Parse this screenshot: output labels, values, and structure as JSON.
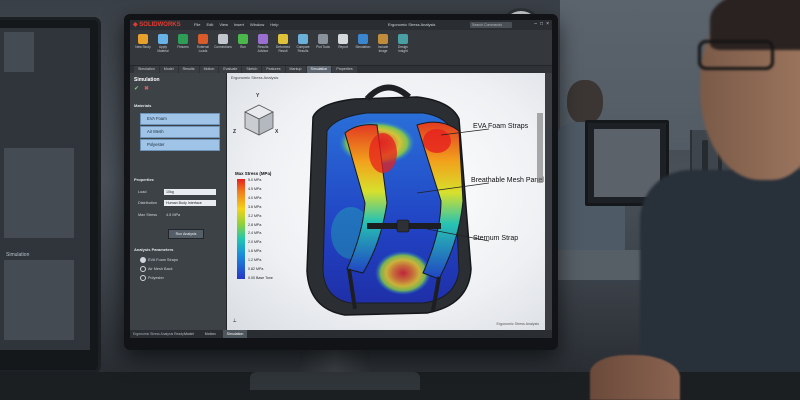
{
  "app": {
    "brand": "SOLIDWORKS",
    "menu": [
      "File",
      "Edit",
      "View",
      "Insert",
      "Window",
      "Help"
    ],
    "document_title": "Ergonomic Stress Analysis",
    "search_placeholder": "Search Commands"
  },
  "ribbon": {
    "buttons": [
      {
        "label": "New Study",
        "color": "#e7a02b"
      },
      {
        "label": "Apply Material",
        "color": "#67b2e6"
      },
      {
        "label": "Fixtures",
        "color": "#2e9e57"
      },
      {
        "label": "External Loads",
        "color": "#d95a2b"
      },
      {
        "label": "Connections",
        "color": "#c0c6cc"
      },
      {
        "label": "Run",
        "color": "#4bb84b"
      },
      {
        "label": "Results Advisor",
        "color": "#9b6fd1"
      },
      {
        "label": "Deformed Result",
        "color": "#e0c13a"
      },
      {
        "label": "Compare Results",
        "color": "#6ab0d8"
      },
      {
        "label": "Plot Tools",
        "color": "#8a939c"
      },
      {
        "label": "Report",
        "color": "#d6d9dc"
      },
      {
        "label": "Simulation",
        "color": "#3b86d1"
      },
      {
        "label": "Include Image",
        "color": "#c28d3a"
      },
      {
        "label": "Design Insight",
        "color": "#4a9fa5"
      }
    ]
  },
  "tabs": [
    "Simulation",
    "Model",
    "Results",
    "Motion",
    "Evaluate",
    "Sketch",
    "Features",
    "Markup",
    "Simulation",
    "Properties"
  ],
  "active_tab_index": 8,
  "panel": {
    "title": "Simulation",
    "materials_heading": "Materials",
    "materials": [
      "EVA Foam",
      "Air Mesh",
      "Polyester"
    ],
    "properties_heading": "Properties",
    "load_label": "Load",
    "load_value": "10kg",
    "distribution_label": "Distribution",
    "distribution_value": "Human Body Interface",
    "max_stress_label": "Max Stress",
    "max_stress_value": "4.5 MPa",
    "run_button": "Run Analysis",
    "analysis_heading": "Analysis Parameters",
    "options": [
      {
        "label": "EVA Foam Straps",
        "checked": true
      },
      {
        "label": "Air Mesh Back",
        "checked": false
      },
      {
        "label": "Polyester",
        "checked": false
      }
    ]
  },
  "viewport": {
    "title": "Ergonomic Stress Analysis",
    "legend_title": "Max Stress (MPa)",
    "legend_values": [
      "5.0 MPa",
      "4.5 MPa",
      "4.0 MPa",
      "3.6 MPa",
      "3.2 MPa",
      "2.8 MPa",
      "2.4 MPa",
      "2.0 MPa",
      "1.6 MPa",
      "1.2 MPa",
      "0.82 MPa",
      "0.00 Base Tone"
    ],
    "callouts": {
      "straps": "EVA Foam Straps",
      "panel": "Breathable Mesh Panel",
      "sternum": "Sternum Strap"
    },
    "cube_axes": {
      "y": "Y",
      "x": "X",
      "z": "Z"
    },
    "sim_footer": "Ergonomic Stress Analysis"
  },
  "bottom_tabs": [
    "Model",
    "Motion",
    "Simulation"
  ],
  "bottom_active_index": 2,
  "status": "Ergonomic Stress Analysis Ready",
  "left_monitor": {
    "label": "Simulation"
  },
  "colors": {
    "stress_high": "#e6201e",
    "stress_mid": "#8fd13a",
    "stress_low": "#2437c8",
    "brand": "#e23a30"
  }
}
